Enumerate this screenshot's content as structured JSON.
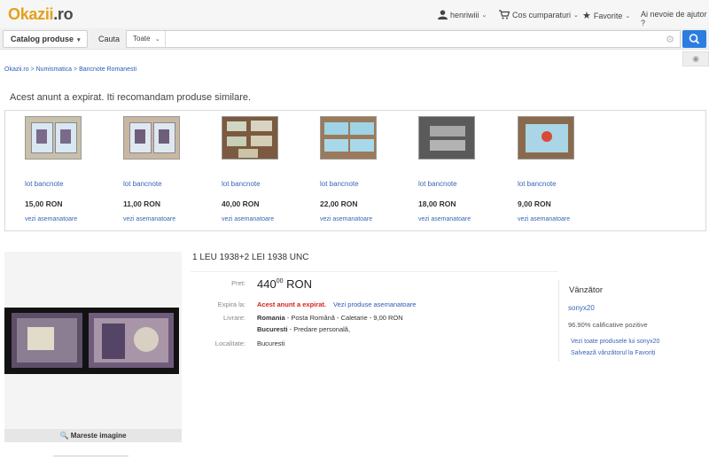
{
  "header": {
    "logo_ok": "Okazii",
    "logo_tld": ".ro",
    "user_name": "henriwiii",
    "cart_label": "Cos cumparaturi",
    "favorites_label": "Favorite",
    "help_label": "Ai nevoie de ajutor ?"
  },
  "search": {
    "catalog_label": "Catalog produse",
    "cauta_label": "Cauta",
    "scope_value": "Toate",
    "query_value": ""
  },
  "breadcrumb": [
    "Okazii.ro",
    "Numismatica",
    "Bancnote Romanesti"
  ],
  "breadcrumb_separator": ">",
  "expired_notice": "Acest anunt a expirat. Iti recomandam produse similare.",
  "similar_products": [
    {
      "name": "lot bancnote",
      "price": "15,00 RON",
      "link": "vezi asemanatoare",
      "thumb": "notes-blue"
    },
    {
      "name": "lot bancnote",
      "price": "11,00 RON",
      "link": "vezi asemanatoare",
      "thumb": "notes-blue"
    },
    {
      "name": "lot bancnote",
      "price": "40,00 RON",
      "link": "vezi asemanatoare",
      "thumb": "notes-green"
    },
    {
      "name": "lot bancnote",
      "price": "22,00 RON",
      "link": "vezi asemanatoare",
      "thumb": "notes-polymer"
    },
    {
      "name": "lot bancnote",
      "price": "18,00 RON",
      "link": "vezi asemanatoare",
      "thumb": "notes-grey"
    },
    {
      "name": "lot bancnote",
      "price": "9,00 RON",
      "link": "vezi asemanatoare",
      "thumb": "notes-eclipse"
    }
  ],
  "product": {
    "title": "1 LEU 1938+2 LEI 1938 UNC",
    "zoom_label": "Mareste imagine",
    "price_label": "Pret:",
    "price_int": "440",
    "price_dec": "00",
    "price_currency": "RON",
    "expires_label": "Expira la:",
    "expires_value": "Acest anunt a expirat.",
    "similar_link": "Vezi produse asemanatoare",
    "delivery_label": "Livrare:",
    "delivery_line1_country": "Romania",
    "delivery_line1_rest": " - Posta Română - Caletarie - 9,00 RON",
    "delivery_line2_city": "Bucuresti",
    "delivery_line2_rest": " - Predare personală,",
    "location_label": "Localitate:",
    "location_value": "Bucuresti"
  },
  "seller": {
    "heading": "Vânzător",
    "name": "sonyx20",
    "rating": "96.90% calificative pozitive",
    "link_all": "Vezi toate produsele lui sonyx20",
    "link_fav": "Salvează vânzătorul la Favoriți"
  },
  "colors": {
    "logo_accent": "#e3a11b",
    "link_blue": "#3a66b5",
    "search_button": "#2d7de0",
    "expired_red": "#d61f1f"
  }
}
